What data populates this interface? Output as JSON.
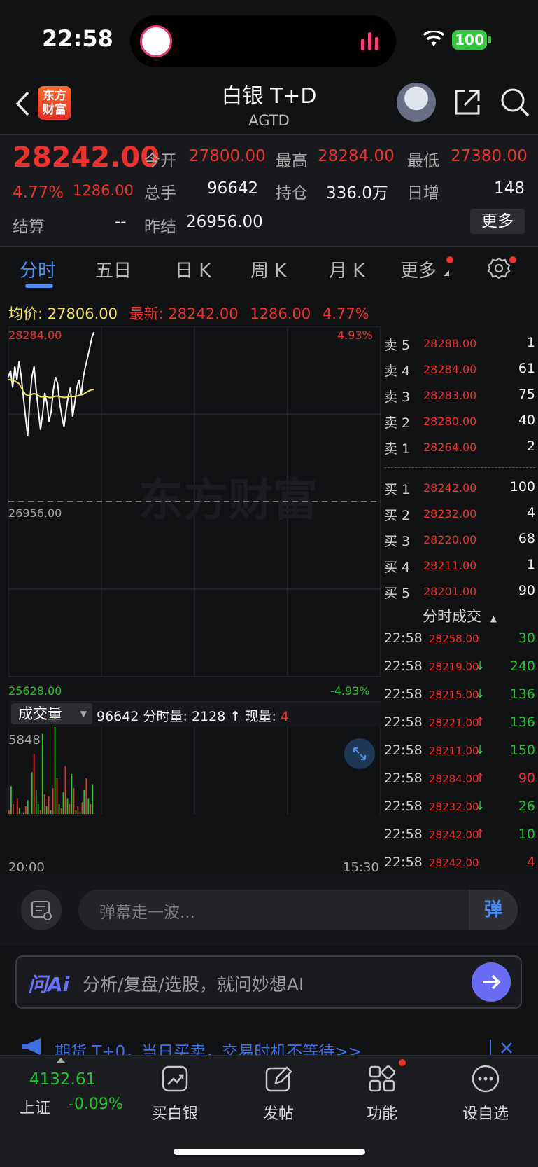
{
  "status_bar": {
    "time": "22:58",
    "battery": "100"
  },
  "header": {
    "brand_logo": "东方财富",
    "title": "白银 T+D",
    "code": "AGTD"
  },
  "quote": {
    "price": "28242.00",
    "change_pct": "4.77%",
    "change": "1286.00",
    "open_label": "今开",
    "open": "27800.00",
    "high_label": "最高",
    "high": "28284.00",
    "low_label": "最低",
    "low": "27380.00",
    "volume_label": "总手",
    "volume": "96642",
    "position_label": "持仓",
    "position": "336.0万",
    "daily_inc_label": "日增",
    "daily_inc": "148",
    "settle_label": "结算",
    "settle": "--",
    "prev_settle_label": "昨结",
    "prev_settle": "26956.00",
    "more_label": "更多"
  },
  "tabs": [
    {
      "label": "分时",
      "active": true
    },
    {
      "label": "五日"
    },
    {
      "label": "日 K"
    },
    {
      "label": "周 K"
    },
    {
      "label": "月 K"
    },
    {
      "label": "更多"
    }
  ],
  "summary": {
    "avg_label": "均价:",
    "avg": "27806.00",
    "latest_label": "最新:",
    "latest": "28242.00",
    "change": "1286.00",
    "change_pct": "4.77%"
  },
  "chart_data": {
    "type": "line",
    "y_max_label": "28284.00",
    "y_max_pct": "4.93%",
    "y_mid_label": "26956.00",
    "y_min_label": "25628.00",
    "y_min_pct": "-4.93%",
    "ylim": [
      25628,
      28284
    ],
    "reference": 26956,
    "watermark": "东方财富",
    "x_start": "20:00",
    "x_end": "15:30",
    "session_fraction_elapsed": 0.23,
    "series": [
      {
        "color": "#f5f5f5",
        "values": [
          27900,
          27950,
          27820,
          27980,
          27880,
          28020,
          27900,
          27750,
          27600,
          27450,
          27720,
          27900,
          27980,
          27800,
          27650,
          27500,
          27620,
          27780,
          27700,
          27560,
          27640,
          27800,
          27900,
          27850,
          27700,
          27600,
          27520,
          27650,
          27760,
          27820,
          27600,
          27700,
          27820,
          27880,
          27760,
          27900,
          27980,
          28050,
          28120,
          28200,
          28242
        ]
      },
      {
        "color": "#f1e34a",
        "values": [
          27880,
          27880,
          27870,
          27870,
          27860,
          27850,
          27820,
          27790,
          27770,
          27760,
          27760,
          27770,
          27775,
          27770,
          27760,
          27750,
          27750,
          27755,
          27752,
          27745,
          27745,
          27750,
          27755,
          27755,
          27752,
          27748,
          27745,
          27746,
          27750,
          27755,
          27752,
          27752,
          27756,
          27762,
          27765,
          27770,
          27780,
          27790,
          27798,
          27804,
          27806
        ]
      }
    ],
    "volume": {
      "label": "成交量",
      "total": "96642",
      "minute_label": "分时量:",
      "minute": "2128",
      "current_label": "现量:",
      "current": "4",
      "y_max": "5848",
      "bars": [
        600,
        1800,
        900,
        400,
        1200,
        700,
        300,
        500,
        800,
        1100,
        400,
        2500,
        3400,
        1600,
        900,
        600,
        4400,
        1400,
        800,
        1300,
        600,
        1700,
        5848,
        2200,
        900,
        700,
        1500,
        2800,
        1200,
        900,
        2400,
        1700,
        600,
        800,
        500,
        1000,
        1600,
        2200,
        1200,
        900,
        1900
      ],
      "bar_colors": [
        "r",
        "g",
        "r",
        "g",
        "r",
        "g",
        "r",
        "g",
        "r",
        "g",
        "r",
        "g",
        "r",
        "g",
        "g",
        "r",
        "g",
        "r",
        "g",
        "r",
        "g",
        "r",
        "g",
        "r",
        "g",
        "r",
        "g",
        "r",
        "g",
        "r",
        "g",
        "r",
        "g",
        "r",
        "g",
        "r",
        "g",
        "r",
        "g",
        "r",
        "g"
      ]
    }
  },
  "order_book": {
    "asks": [
      {
        "side": "卖 5",
        "price": "28288.00",
        "vol": "1"
      },
      {
        "side": "卖 4",
        "price": "28284.00",
        "vol": "61"
      },
      {
        "side": "卖 3",
        "price": "28283.00",
        "vol": "75"
      },
      {
        "side": "卖 2",
        "price": "28280.00",
        "vol": "40"
      },
      {
        "side": "卖 1",
        "price": "28264.00",
        "vol": "2"
      }
    ],
    "bids": [
      {
        "side": "买 1",
        "price": "28242.00",
        "vol": "100"
      },
      {
        "side": "买 2",
        "price": "28232.00",
        "vol": "4"
      },
      {
        "side": "买 3",
        "price": "28220.00",
        "vol": "68"
      },
      {
        "side": "买 4",
        "price": "28211.00",
        "vol": "1"
      },
      {
        "side": "买 5",
        "price": "28201.00",
        "vol": "90"
      }
    ]
  },
  "trades": {
    "title": "分时成交",
    "rows": [
      {
        "time": "22:58",
        "price": "28258.00",
        "dir": "",
        "vol": "30",
        "vol_color": "green"
      },
      {
        "time": "22:58",
        "price": "28219.00",
        "dir": "↓",
        "vol": "240",
        "vol_color": "green"
      },
      {
        "time": "22:58",
        "price": "28215.00",
        "dir": "↓",
        "vol": "136",
        "vol_color": "green"
      },
      {
        "time": "22:58",
        "price": "28221.00",
        "dir": "↑",
        "vol": "136",
        "vol_color": "green"
      },
      {
        "time": "22:58",
        "price": "28211.00",
        "dir": "↓",
        "vol": "150",
        "vol_color": "green"
      },
      {
        "time": "22:58",
        "price": "28284.00",
        "dir": "↑",
        "vol": "90",
        "vol_color": "red"
      },
      {
        "time": "22:58",
        "price": "28232.00",
        "dir": "↓",
        "vol": "26",
        "vol_color": "green"
      },
      {
        "time": "22:58",
        "price": "28242.00",
        "dir": "↑",
        "vol": "10",
        "vol_color": "green"
      },
      {
        "time": "22:58",
        "price": "28242.00",
        "dir": "",
        "vol": "4",
        "vol_color": "red"
      }
    ]
  },
  "danmu": {
    "placeholder": "弹幕走一波...",
    "button": "弹"
  },
  "ai": {
    "logo": "问Ai",
    "placeholder": "分析/复盘/选股，就问妙想AI"
  },
  "promo": {
    "text": "期货 T+0，当日买卖，交易时机不等待>>"
  },
  "bottom_bar": {
    "index_value": "4132.61",
    "index_name": "上证",
    "index_change": "-0.09%",
    "items": [
      "买白银",
      "发帖",
      "功能",
      "设自选"
    ]
  },
  "colors": {
    "up": "#f0302b",
    "down": "#22c42a",
    "accent": "#4a8cf0",
    "avg_line": "#f1e34a"
  }
}
